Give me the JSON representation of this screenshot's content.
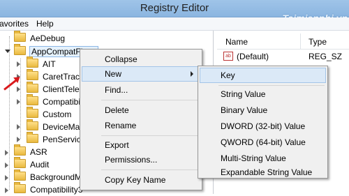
{
  "window": {
    "title": "Registry Editor",
    "watermark": "Taimienphi.vn"
  },
  "menubar": {
    "favorites": "avorites",
    "help": "Help"
  },
  "tree": {
    "items": [
      {
        "label": "AeDebug"
      },
      {
        "label": "AppCompatFlags"
      },
      {
        "label": "AIT"
      },
      {
        "label": "CaretTrack"
      },
      {
        "label": "ClientTeler"
      },
      {
        "label": "Compatibili"
      },
      {
        "label": "Custom"
      },
      {
        "label": "DeviceMap"
      },
      {
        "label": "PenService"
      },
      {
        "label": "ASR"
      },
      {
        "label": "Audit"
      },
      {
        "label": "BackgroundM"
      },
      {
        "label": "Compatibility3"
      }
    ]
  },
  "list": {
    "col_name": "Name",
    "col_type": "Type",
    "rows": [
      {
        "name": "(Default)",
        "type": "REG_SZ"
      }
    ]
  },
  "context_menu": {
    "collapse": "Collapse",
    "new": "New",
    "find": "Find...",
    "delete": "Delete",
    "rename": "Rename",
    "export": "Export",
    "permissions": "Permissions...",
    "copy_key_name": "Copy Key Name"
  },
  "submenu": {
    "key": "Key",
    "string": "String Value",
    "binary": "Binary Value",
    "dword": "DWORD (32-bit) Value",
    "qword": "QWORD (64-bit) Value",
    "multi": "Multi-String Value",
    "expandable": "Expandable String Value"
  }
}
